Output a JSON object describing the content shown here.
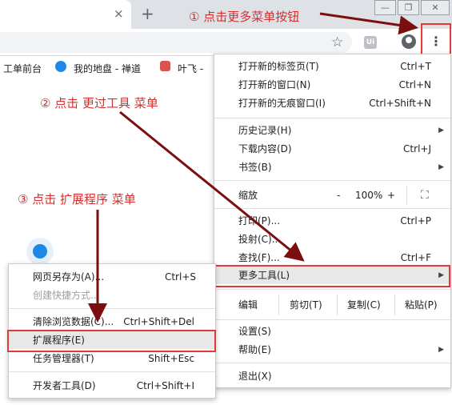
{
  "browser": {
    "tab_close": "×",
    "new_tab": "+",
    "window_buttons": [
      "—",
      "❐",
      "✕"
    ],
    "star_icon": "☆",
    "ext_label": "Ui",
    "kebab": "⋮"
  },
  "bookmarks": [
    {
      "label": "工单前台"
    },
    {
      "label": "我的地盘 - 禅道"
    },
    {
      "label": "叶飞 -"
    }
  ],
  "annotations": {
    "step1": "① 点击更多菜单按钮",
    "step2": "② 点击 更过工具 菜单",
    "step3": "③ 点击 扩展程序 菜单"
  },
  "main_menu": {
    "new_tab": {
      "label": "打开新的标签页(T)",
      "shortcut": "Ctrl+T"
    },
    "new_window": {
      "label": "打开新的窗口(N)",
      "shortcut": "Ctrl+N"
    },
    "incognito": {
      "label": "打开新的无痕窗口(I)",
      "shortcut": "Ctrl+Shift+N"
    },
    "history": {
      "label": "历史记录(H)"
    },
    "downloads": {
      "label": "下载内容(D)",
      "shortcut": "Ctrl+J"
    },
    "bookmarks": {
      "label": "书签(B)"
    },
    "zoom": {
      "label": "缩放",
      "minus": "-",
      "value": "100%",
      "plus": "+",
      "fullscreen": "⛶"
    },
    "print": {
      "label": "打印(P)...",
      "shortcut": "Ctrl+P"
    },
    "cast": {
      "label": "投射(C)..."
    },
    "find": {
      "label": "查找(F)...",
      "shortcut": "Ctrl+F"
    },
    "more_tools": {
      "label": "更多工具(L)"
    },
    "edit": {
      "label": "编辑",
      "cut": "剪切(T)",
      "copy": "复制(C)",
      "paste": "粘贴(P)"
    },
    "settings": {
      "label": "设置(S)"
    },
    "help": {
      "label": "帮助(E)"
    },
    "exit": {
      "label": "退出(X)"
    }
  },
  "sub_menu": {
    "save_page": {
      "label": "网页另存为(A)...",
      "shortcut": "Ctrl+S"
    },
    "create_shortcut": {
      "label": "创建快捷方式..."
    },
    "clear_data": {
      "label": "清除浏览数据(C)...",
      "shortcut": "Ctrl+Shift+Del"
    },
    "extensions": {
      "label": "扩展程序(E)"
    },
    "task_manager": {
      "label": "任务管理器(T)",
      "shortcut": "Shift+Esc"
    },
    "dev_tools": {
      "label": "开发者工具(D)",
      "shortcut": "Ctrl+Shift+I"
    }
  },
  "colors": {
    "annotation": "#d32f2f",
    "arrow": "#7b0f0f",
    "highlight_box": "#e53935"
  }
}
